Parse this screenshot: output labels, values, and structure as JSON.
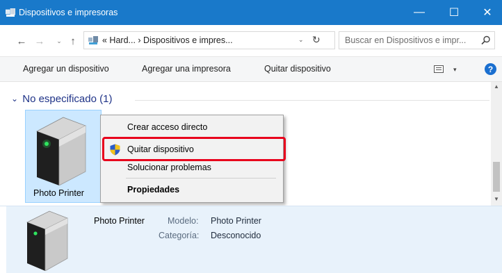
{
  "window": {
    "title": "Dispositivos e impresoras",
    "title_icon": "devices-printers-icon",
    "minimize_glyph": "—",
    "maximize_glyph": "☐",
    "close_glyph": "✕"
  },
  "navigation": {
    "back_glyph": "←",
    "forward_glyph": "→",
    "recent_glyph": "⌄",
    "up_glyph": "↑",
    "address_text": "« Hard...  ›  Dispositivos e impres...",
    "address_dropdown_glyph": "⌄",
    "refresh_glyph": "↻",
    "search_placeholder": "Buscar en Dispositivos e impr..."
  },
  "command_bar": {
    "add_device": "Agregar un dispositivo",
    "add_printer": "Agregar una impresora",
    "remove_device": "Quitar dispositivo",
    "view_dropdown_glyph": "▾",
    "help": "?"
  },
  "group": {
    "chevron": "⌄",
    "header": "No especificado (1)"
  },
  "device": {
    "name": "Photo Printer",
    "icon": "printer-device-icon"
  },
  "context_menu": {
    "items": [
      {
        "label": "Crear acceso directo"
      },
      {
        "label": "Quitar dispositivo",
        "icon": "uac-shield-icon",
        "highlighted": true
      },
      {
        "label": "Solucionar problemas"
      },
      {
        "label": "Propiedades",
        "bold": true
      }
    ],
    "highlight_color": "#e8001c"
  },
  "details": {
    "name": "Photo Printer",
    "model_label": "Modelo:",
    "model_value": "Photo Printer",
    "category_label": "Categoría:",
    "category_value": "Desconocido"
  },
  "scrollbar": {
    "up_glyph": "▲",
    "down_glyph": "▼"
  },
  "colors": {
    "titlebar": "#1979ca",
    "selection": "#cce8ff",
    "details_bg": "#e8f2fb",
    "group_header": "#1e3287"
  }
}
